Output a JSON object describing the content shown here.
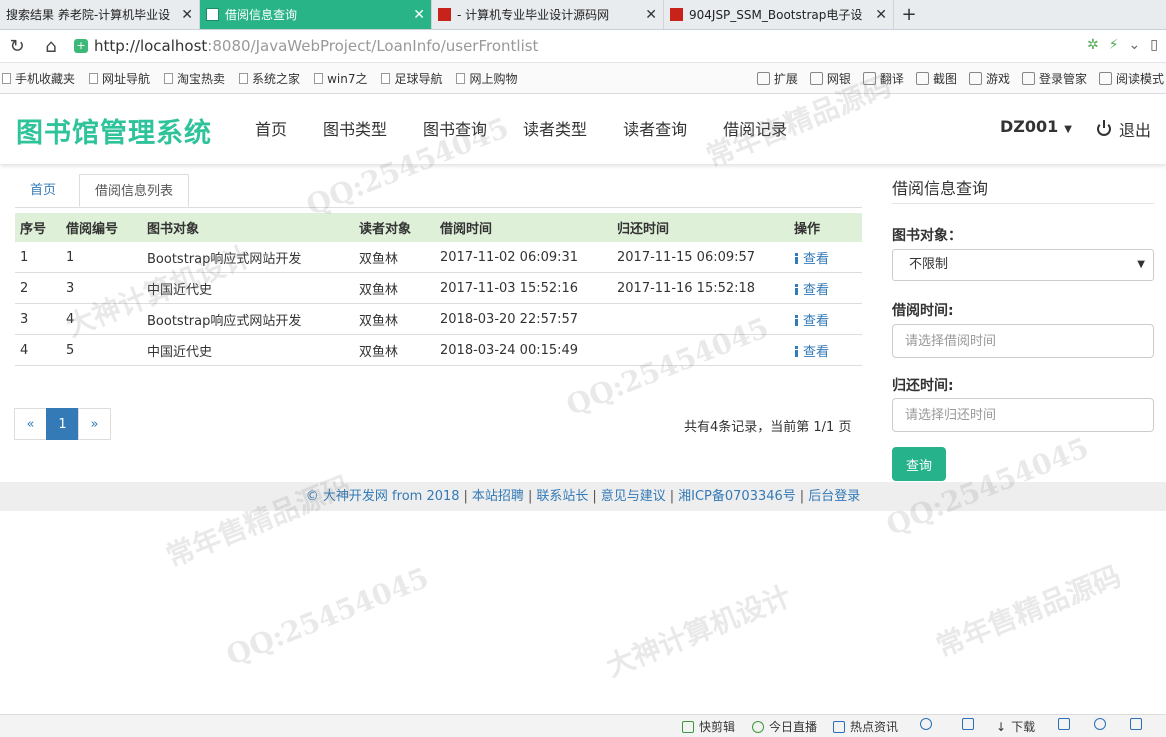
{
  "browser": {
    "tabs": [
      {
        "title": "搜索结果 养老院-计算机毕业设",
        "active": false
      },
      {
        "title": "借阅信息查询",
        "active": true
      },
      {
        "title": "- 计算机专业毕业设计源码网",
        "active": false
      },
      {
        "title": "904JSP_SSM_Bootstrap电子设",
        "active": false
      }
    ],
    "new_tab_label": "+",
    "url_host": "http://localhost",
    "url_rest": ":8080/JavaWebProject/LoanInfo/userFrontlist",
    "bookmarks": [
      "手机收藏夹",
      "网址导航",
      "淘宝热卖",
      "系统之家",
      "win7之",
      "足球导航",
      "网上购物"
    ],
    "bookmarks_right": [
      "扩展",
      "网银",
      "翻译",
      "截图",
      "游戏",
      "登录管家",
      "阅读模式"
    ]
  },
  "site": {
    "brand": "图书馆管理系统",
    "nav": [
      "首页",
      "图书类型",
      "图书查询",
      "读者类型",
      "读者查询",
      "借阅记录"
    ],
    "user": "DZ001",
    "logout": "退出"
  },
  "breadcrumb": {
    "home": "首页",
    "current": "借阅信息列表"
  },
  "table": {
    "headers": [
      "序号",
      "借阅编号",
      "图书对象",
      "读者对象",
      "借阅时间",
      "归还时间",
      "操作"
    ],
    "action_label": "查看",
    "rows": [
      [
        "1",
        "1",
        "Bootstrap响应式网站开发",
        "双鱼林",
        "2017-11-02 06:09:31",
        "2017-11-15 06:09:57"
      ],
      [
        "2",
        "3",
        "中国近代史",
        "双鱼林",
        "2017-11-03 15:52:16",
        "2017-11-16 15:52:18"
      ],
      [
        "3",
        "4",
        "Bootstrap响应式网站开发",
        "双鱼林",
        "2018-03-20 22:57:57",
        ""
      ],
      [
        "4",
        "5",
        "中国近代史",
        "双鱼林",
        "2018-03-24 00:15:49",
        ""
      ]
    ]
  },
  "pagination": {
    "prev": "«",
    "current": "1",
    "next": "»",
    "summary": "共有4条记录，当前第 1/1 页"
  },
  "sidebar": {
    "title": "借阅信息查询",
    "book_label": "图书对象：",
    "book_value": "不限制",
    "loan_time_label": "借阅时间:",
    "loan_time_placeholder": "请选择借阅时间",
    "return_time_label": "归还时间:",
    "return_time_placeholder": "请选择归还时间",
    "query_button": "查询"
  },
  "footer": {
    "items": [
      "© 大神开发网 from 2018",
      "本站招聘",
      "联系站长",
      "意见与建议",
      "湘ICP备0703346号",
      "后台登录"
    ]
  },
  "statusbar": [
    "快剪辑",
    "今日直播",
    "热点资讯",
    "下载"
  ],
  "watermark": [
    "QQ:25454045",
    "常年售精品源码",
    "大神计算机设计",
    "QQ:25454045",
    "常年售精品源码",
    "大神计算机设计",
    "QQ:25454045",
    "QQ:25454045",
    "常年售精品源码"
  ],
  "colors": {
    "brand": "#2fc39b",
    "active_tab": "#29b487",
    "link": "#337ab7",
    "table_header": "#dff0d8",
    "query_button": "#26b38b"
  }
}
